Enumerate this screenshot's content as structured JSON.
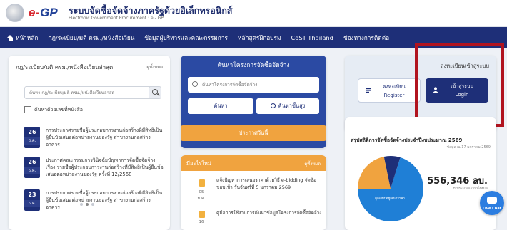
{
  "header": {
    "logo_e": "e-",
    "logo_gp": "GP",
    "title": "ระบบจัดซื้อจัดจ้างภาครัฐด้วยอิเล็กทรอนิกส์",
    "subtitle": "Electronic Government Procurement : e - GP"
  },
  "nav": {
    "items": [
      {
        "label": "หน้าหลัก"
      },
      {
        "label": "กฎ/ระเบียบ/มติ ครม./หนังสือเวียน"
      },
      {
        "label": "ข้อมูลผู้บริหารและคณะกรรมการ"
      },
      {
        "label": "หลักสูตรฝึกอบรม"
      },
      {
        "label": "CoST Thailand"
      },
      {
        "label": "ช่องทางการติดต่อ"
      }
    ]
  },
  "rules_card": {
    "title": "กฎ/ระเบียบ/มติ ครม./หนังสือเวียนล่าสุด",
    "see_all": "ดูทั้งหมด",
    "search_placeholder": "ค้นหา กฎ/ระเบียบ/มติ ครม./หนังสือเวียนล่าสุด",
    "checkbox_label": "ค้นหาด้วยเลขที่หนังสือ",
    "items": [
      {
        "day": "26",
        "month": "ธ.ค.",
        "text": "การประกาศรายชื่อผู้ประกอบการงานก่อสร้างที่มีสิทธิเป็นผู้ยื่นข้อเสนอต่อหน่วยงานของรัฐ สาขางานก่อสร้างอาคาร"
      },
      {
        "day": "26",
        "month": "ธ.ค.",
        "text": "ประกาศคณะกรรมการวินิจฉัยปัญหาการจัดซื้อจัดจ้าง เรื่อง รายชื่อผู้ประกอบการงานก่อสร้างที่มีสิทธิเป็นผู้ยื่นข้อเสนอต่อหน่วยงานของรัฐ ครั้งที่ 12/2568"
      },
      {
        "day": "23",
        "month": "ธ.ค.",
        "text": "การประกาศรายชื่อผู้ประกอบการงานก่อสร้างที่มีสิทธิเป็นผู้ยื่นข้อเสนอต่อหน่วยงานของรัฐ สาขางานก่อสร้างอาคาร"
      }
    ]
  },
  "project_search": {
    "title": "ค้นหาโครงการจัดซื้อจัดจ้าง",
    "placeholder": "ค้นหาโครงการจัดซื้อจัดจ้าง",
    "search_label": "ค้นหา",
    "advanced_label": "ค้นหาขั้นสูง",
    "announce_label": "ประกาศวันนี้"
  },
  "whats_new": {
    "title": "มีอะไรใหม่",
    "see_all": "ดูทั้งหมด",
    "items": [
      {
        "day": "05",
        "month": "ม.ค.",
        "text": "แจ้งปัญหาการเสนอราคาด้วยวิธี e-bidding จัดซ้อ ขอบเข้า วันจันทร์ที่ 5 มกราคม 2569"
      },
      {
        "day": "16",
        "month": "",
        "text": "คู่มือการใช้งานการค้นหาข้อมูลโครงการจัดซื้อจัดจ้าง"
      }
    ]
  },
  "registration": {
    "title": "ลงทะเบียนเข้าสู่ระบบ",
    "register_label_th": "ลงทะเบียน",
    "register_label_en": "Register",
    "login_label_th": "เข้าสู่ระบบ",
    "login_label_en": "Login"
  },
  "stats": {
    "title": "สรุปสถิติการจัดซื้อจัดจ้างประจำปีงบประมาณ 2569",
    "subtitle": "ข้อมูล ณ 17 มกราคม 2569",
    "value": "556,346 ลบ.",
    "note": "งบประมาณรวมทั้งหมด",
    "slice_label": "คุณสมบัติผู้เสนอราคา",
    "slices": [
      {
        "fraction": 0.7,
        "color": "#1f7fd6"
      },
      {
        "fraction": 0.22,
        "color": "#f0a33f"
      },
      {
        "fraction": 0.08,
        "color": "#1e2f78"
      }
    ]
  },
  "livechat": {
    "label": "Live Chat"
  }
}
